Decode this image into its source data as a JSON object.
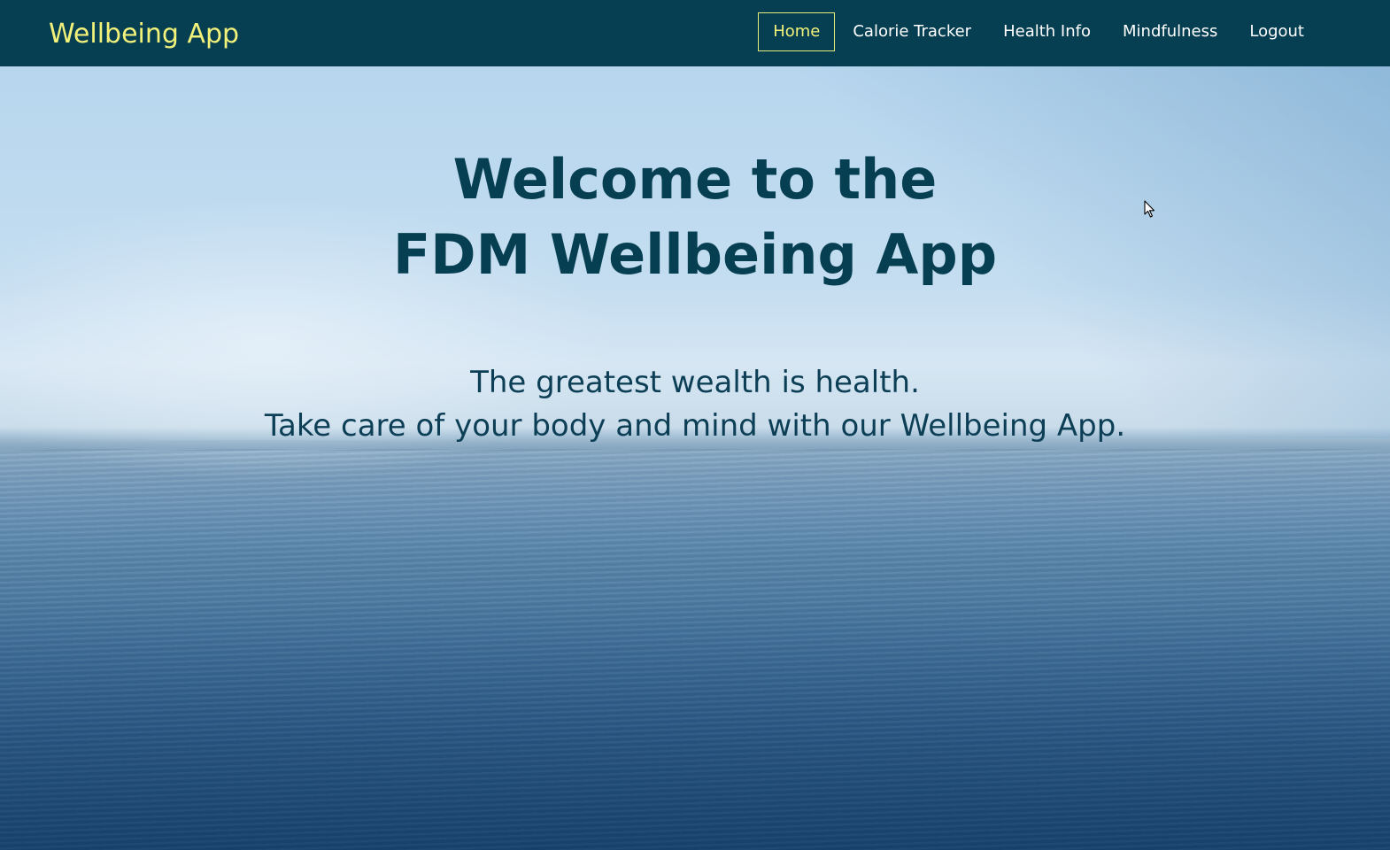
{
  "navbar": {
    "brand": "Wellbeing App",
    "links": [
      {
        "label": "Home",
        "active": true
      },
      {
        "label": "Calorie Tracker",
        "active": false
      },
      {
        "label": "Health Info",
        "active": false
      },
      {
        "label": "Mindfulness",
        "active": false
      },
      {
        "label": "Logout",
        "active": false
      }
    ]
  },
  "hero": {
    "title_line1": "Welcome to the",
    "title_line2": "FDM Wellbeing App",
    "subtitle_line1": "The greatest wealth is health.",
    "subtitle_line2": "Take care of your body and mind with our Wellbeing App.",
    "background": "ocean-horizon-image"
  },
  "colors": {
    "navbar_bg": "#073f52",
    "brand_accent": "#f2f27a",
    "heading": "#073f52"
  }
}
